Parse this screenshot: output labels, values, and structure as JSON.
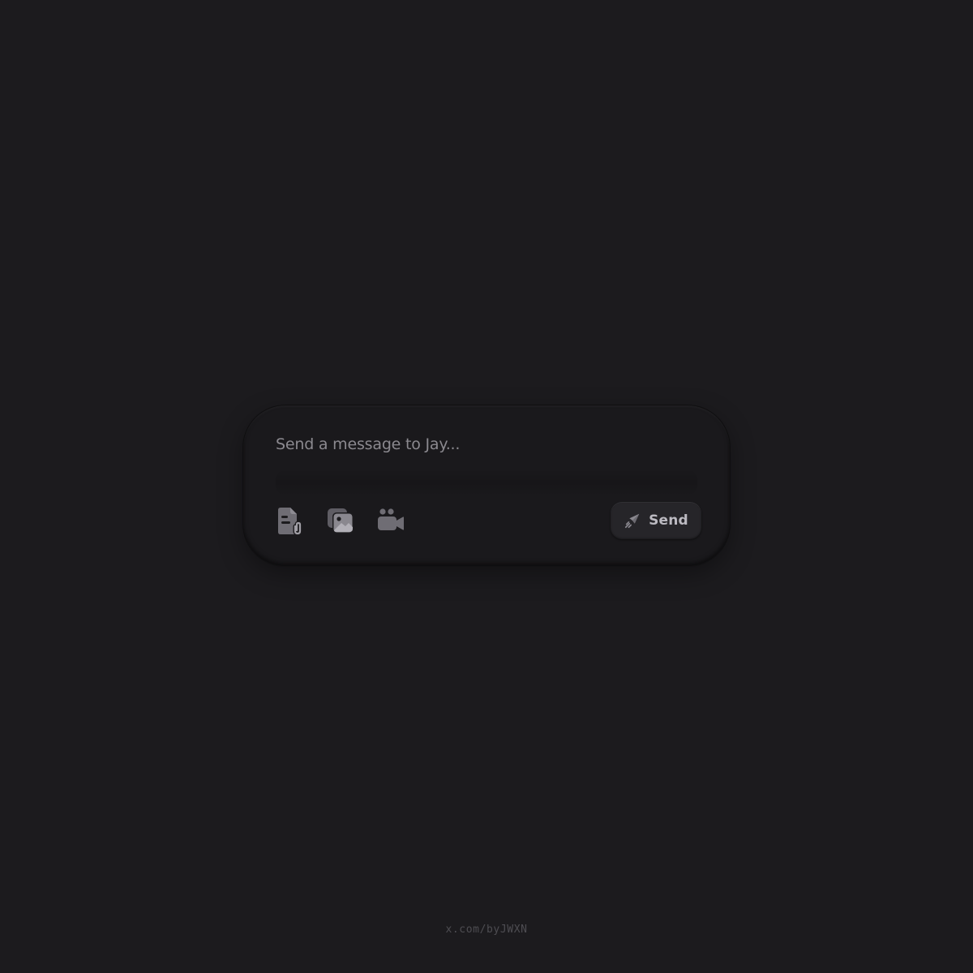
{
  "composer": {
    "placeholder": "Send a message to Jay...",
    "value": "",
    "tools": [
      {
        "icon": "file-attachment-icon"
      },
      {
        "icon": "image-gallery-icon"
      },
      {
        "icon": "video-call-icon"
      }
    ],
    "send": {
      "label": "Send",
      "icon": "paper-plane-icon"
    }
  },
  "footer": {
    "handle": "x.com/byJWXN"
  },
  "colors": {
    "background": "#1c1b1e",
    "composer_surface": "#1a191c",
    "send_button": "#262529",
    "icon": "#7d7b82",
    "text_muted": "#8b898f",
    "send_text": "#bcbac1",
    "footer_text": "#4e4d52"
  }
}
